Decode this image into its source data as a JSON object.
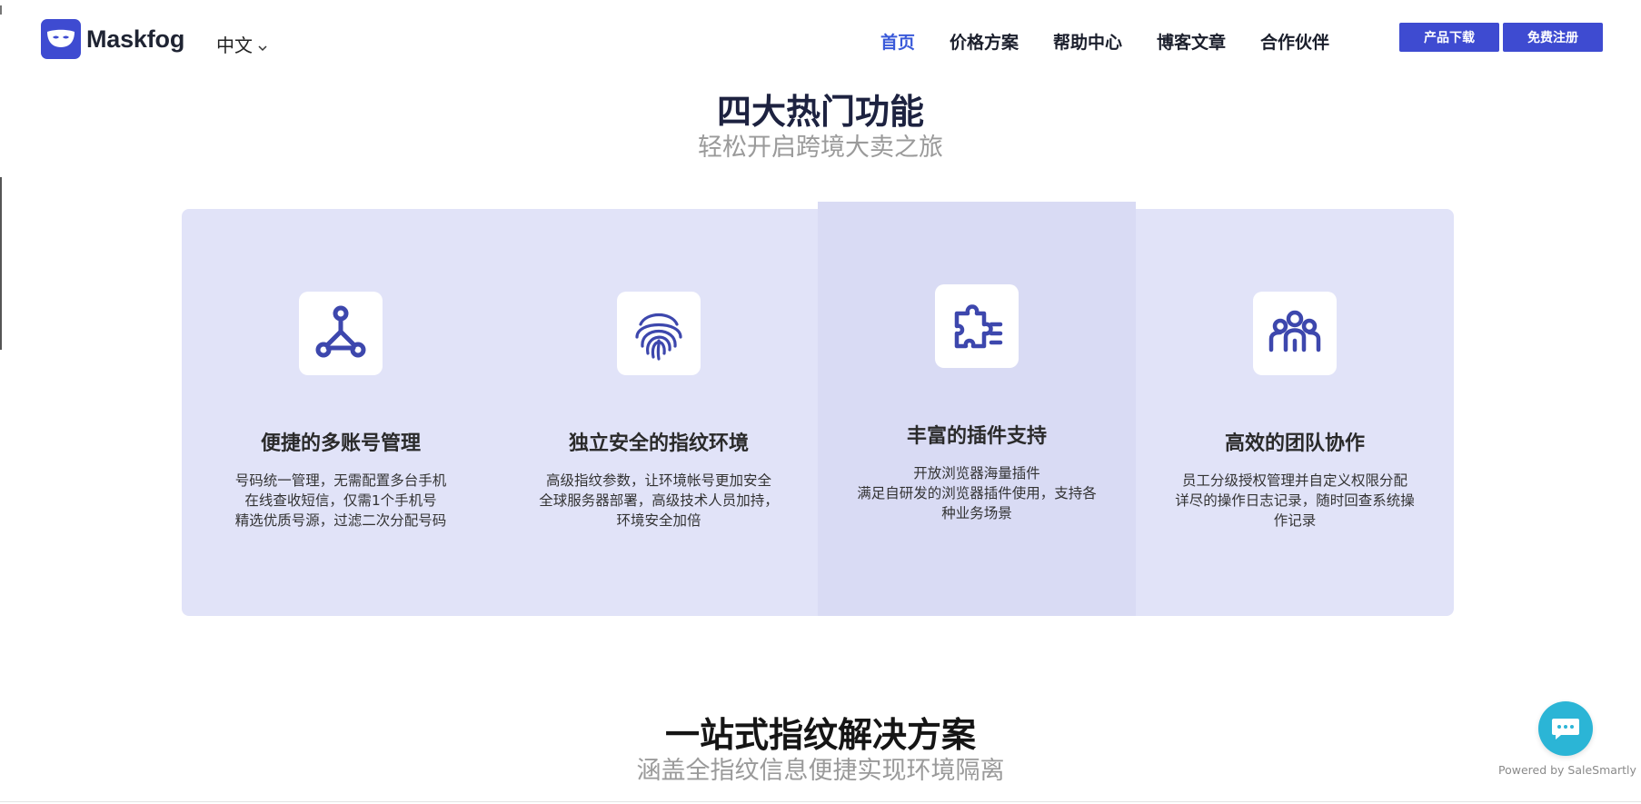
{
  "brand": {
    "name": "Maskfog"
  },
  "header": {
    "language": "中文",
    "nav": [
      {
        "label": "首页",
        "active": true
      },
      {
        "label": "价格方案",
        "active": false
      },
      {
        "label": "帮助中心",
        "active": false
      },
      {
        "label": "博客文章",
        "active": false
      },
      {
        "label": "合作伙伴",
        "active": false
      }
    ],
    "download_label": "产品下载",
    "register_label": "免费注册"
  },
  "features_section": {
    "title": "四大热门功能",
    "subtitle": "轻松开启跨境大卖之旅",
    "items": [
      {
        "icon": "network-nodes-icon",
        "title": "便捷的多账号管理",
        "desc": [
          "号码统一管理，无需配置多台手机",
          "在线查收短信，仅需1个手机号",
          "精选优质号源，过滤二次分配号码"
        ]
      },
      {
        "icon": "fingerprint-icon",
        "title": "独立安全的指纹环境",
        "desc": [
          "高级指纹参数，让环境帐号更加安全",
          "全球服务器部署，高级技术人员加持，",
          "环境安全加倍"
        ]
      },
      {
        "icon": "puzzle-plugin-icon",
        "title": "丰富的插件支持",
        "desc": [
          "开放浏览器海量插件",
          "满足自研发的浏览器插件使用，支持各",
          "种业务场景"
        ]
      },
      {
        "icon": "team-icon",
        "title": "高效的团队协作",
        "desc": [
          "员工分级授权管理并自定义权限分配",
          "详尽的操作日志记录，随时回查系统操",
          "作记录"
        ]
      }
    ]
  },
  "solution_section": {
    "title": "一站式指纹解决方案",
    "subtitle": "涵盖全指纹信息便捷实现环境隔离"
  },
  "chat_widget": {
    "powered_by": "Powered by SaleSmartly"
  },
  "colors": {
    "primary": "#3e4bd1",
    "nav_active": "#3a5ad9",
    "panel": "#e1e3f8",
    "chat": "#2bb5d6"
  }
}
